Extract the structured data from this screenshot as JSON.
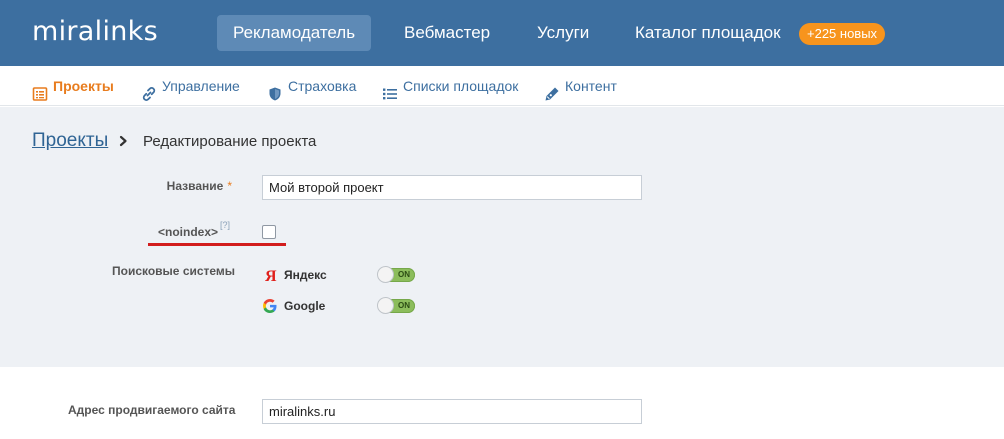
{
  "header": {
    "logo": "miralinks",
    "nav": [
      {
        "label": "Рекламодатель",
        "active": true
      },
      {
        "label": "Вебмастер",
        "active": false
      },
      {
        "label": "Услуги",
        "active": false
      },
      {
        "label": "Каталог площадок",
        "active": false
      }
    ],
    "catalog_badge": "+225 новых"
  },
  "subnav": {
    "items": [
      {
        "label": "Проекты",
        "icon": "list-icon",
        "active": true
      },
      {
        "label": "Управление",
        "icon": "link-icon",
        "active": false
      },
      {
        "label": "Страховка",
        "icon": "shield-icon",
        "active": false
      },
      {
        "label": "Списки площадок",
        "icon": "bullet-list-icon",
        "active": false
      },
      {
        "label": "Контент",
        "icon": "pen-icon",
        "active": false
      }
    ]
  },
  "breadcrumb": {
    "parent": "Проекты",
    "current": "Редактирование проекта"
  },
  "form": {
    "name_label": "Название",
    "required_mark": "*",
    "name_value": "Мой второй проект",
    "noindex_label": "<noindex>",
    "noindex_help": "[?]",
    "noindex_checked": false,
    "search_label": "Поисковые системы",
    "engines": [
      {
        "name": "Яндекс",
        "icon": "yandex-icon",
        "toggle": "ON"
      },
      {
        "name": "Google",
        "icon": "google-icon",
        "toggle": "ON"
      }
    ],
    "site_label": "Адрес продвигаемого сайта",
    "site_value": "miralinks.ru"
  },
  "colors": {
    "header_bg": "#3d6fa0",
    "active_nav_bg": "#5e8ab6",
    "badge": "#f7941d",
    "accent_orange": "#e87c1e",
    "toggle_on": "#8cbd5c",
    "highlight_red": "#d21d1d"
  }
}
